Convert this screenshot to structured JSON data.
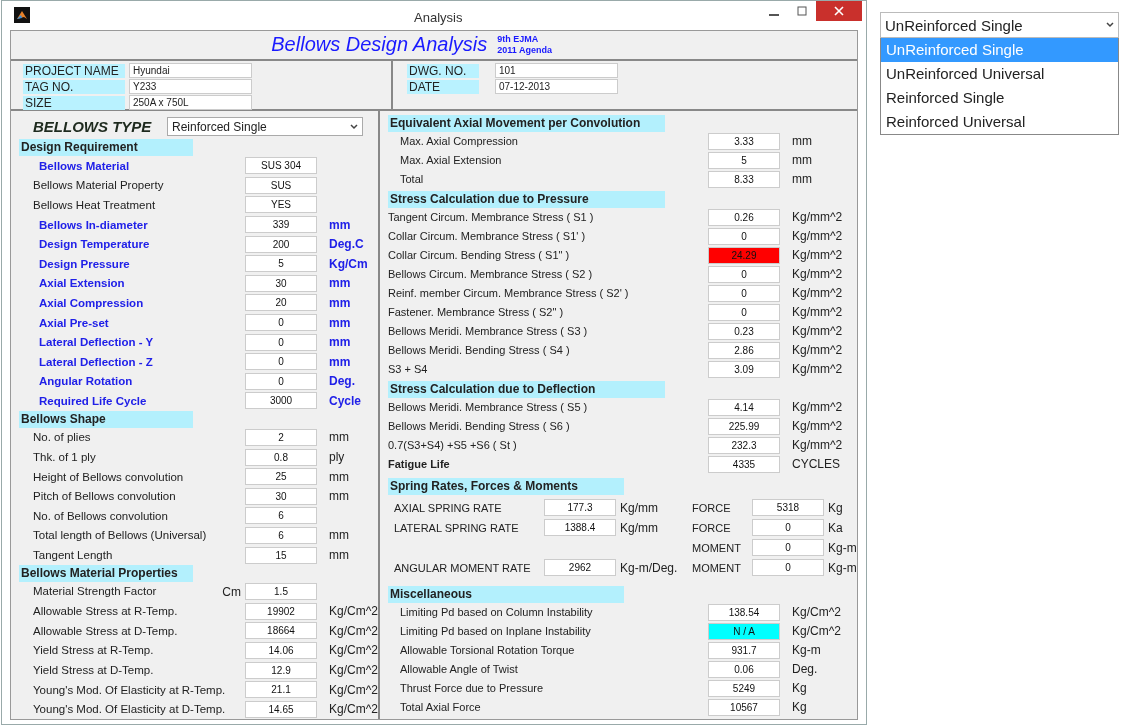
{
  "window": {
    "title": "Analysis"
  },
  "banner": {
    "title": "Bellows Design Analysis",
    "edition": "9th EJMA",
    "agenda": "2011 Agenda"
  },
  "project": [
    {
      "label": "PROJECT NAME",
      "value": "Hyundai"
    },
    {
      "label": "TAG NO.",
      "value": "Y233"
    },
    {
      "label": "SIZE",
      "value": "250A x 750L"
    }
  ],
  "drawing": [
    {
      "label": "DWG. NO.",
      "value": "101"
    },
    {
      "label": "DATE",
      "value": "07-12-2013"
    }
  ],
  "bellows_type": {
    "label": "BELLOWS TYPE",
    "value": "Reinforced Single"
  },
  "left_sections": [
    {
      "title": "Design Requirement",
      "rows": [
        {
          "kind": "key",
          "label": "Bellows  Material",
          "value": "SUS 304"
        },
        {
          "kind": "plain",
          "label": "Bellows  Material Property",
          "value": "SUS"
        },
        {
          "kind": "plain",
          "label": "Bellows  Heat Treatment",
          "value": "YES"
        },
        {
          "kind": "key",
          "label": "Bellows  In-diameter",
          "value": "339",
          "unit": "mm"
        },
        {
          "kind": "key",
          "label": "Design Temperature",
          "value": "200",
          "unit": "Deg.C"
        },
        {
          "kind": "key",
          "label": "Design Pressure",
          "value": "5",
          "unit": "Kg/Cm"
        },
        {
          "kind": "key",
          "label": "Axial Extension",
          "value": "30",
          "unit": "mm"
        },
        {
          "kind": "key",
          "label": "Axial Compression",
          "value": "20",
          "unit": "mm"
        },
        {
          "kind": "key",
          "label": "Axial Pre-set",
          "value": "0",
          "unit": "mm"
        },
        {
          "kind": "key",
          "label": "Lateral Deflection - Y",
          "value": "0",
          "unit": "mm"
        },
        {
          "kind": "key",
          "label": "Lateral Deflection - Z",
          "value": "0",
          "unit": "mm"
        },
        {
          "kind": "key",
          "label": "Angular Rotation",
          "value": "0",
          "unit": "Deg."
        },
        {
          "kind": "key",
          "label": "Required Life Cycle",
          "value": "3000",
          "unit": "Cycle"
        }
      ]
    },
    {
      "title": "Bellows Shape",
      "rows": [
        {
          "kind": "plain",
          "label": "No. of plies",
          "value": "2",
          "unit": "mm"
        },
        {
          "kind": "plain",
          "label": "Thk. of 1 ply",
          "value": "0.8",
          "unit": "ply"
        },
        {
          "kind": "plain",
          "label": "Height of Bellows convolution",
          "value": "25",
          "unit": "mm"
        },
        {
          "kind": "plain",
          "label": "Pitch of Bellows convolution",
          "value": "30",
          "unit": "mm"
        },
        {
          "kind": "plain",
          "label": "No. of Bellows convolution",
          "value": "6"
        },
        {
          "kind": "plain",
          "label": "Total length of Bellows (Universal)",
          "value": "6",
          "unit": "mm"
        },
        {
          "kind": "plain",
          "label": "Tangent Length",
          "value": "15",
          "unit": "mm"
        }
      ]
    },
    {
      "title": "Bellows Material Properties",
      "rows": [
        {
          "kind": "plain",
          "label": "Material Strength Factor",
          "symbol": "Cm",
          "value": "1.5"
        },
        {
          "kind": "plain",
          "label": "Allowable Stress at R-Temp.",
          "value": "19902",
          "unit": "Kg/Cm^2"
        },
        {
          "kind": "plain",
          "label": "Allowable Stress at D-Temp.",
          "value": "18664",
          "unit": "Kg/Cm^2"
        },
        {
          "kind": "plain",
          "label": "Yield Stress at R-Temp.",
          "value": "14.06",
          "unit": "Kg/Cm^2"
        },
        {
          "kind": "plain",
          "label": "Yield Stress at D-Temp.",
          "value": "12.9",
          "unit": "Kg/Cm^2"
        },
        {
          "kind": "plain",
          "label": "Young's Mod. Of Elasticity at R-Temp.",
          "value": "21.1",
          "unit": "Kg/Cm^2"
        },
        {
          "kind": "plain",
          "label": "Young's Mod. Of Elasticity at D-Temp.",
          "value": "14.65",
          "unit": "Kg/Cm^2"
        }
      ]
    }
  ],
  "right_sections": [
    {
      "title": "Equivalent Axial Movement per Convolution",
      "rows": [
        {
          "kind": "plain",
          "label": "Max. Axial Compression",
          "value": "3.33",
          "unit": "mm"
        },
        {
          "kind": "plain",
          "label": "Max. Axial Extension",
          "value": "5",
          "unit": "mm"
        },
        {
          "kind": "plain",
          "label": "Total",
          "value": "8.33",
          "unit": "mm"
        }
      ]
    },
    {
      "title": "Stress Calculation due to Pressure",
      "rows": [
        {
          "kind": "plain",
          "label": "Tangent Circum. Membrance Stress ( S1 )",
          "value": "0.26",
          "unit": "Kg/mm^2"
        },
        {
          "kind": "plain",
          "label": "Collar Circum. Membrance Stress ( S1' )",
          "value": "0",
          "unit": "Kg/mm^2"
        },
        {
          "kind": "plain",
          "label": "Collar Circum. Bending Stress ( S1\" )",
          "value": "24.29",
          "unit": "Kg/mm^2",
          "color": "#ff0000"
        },
        {
          "kind": "plain",
          "label": "Bellows Circum. Membrance Stress ( S2 )",
          "value": "0",
          "unit": "Kg/mm^2"
        },
        {
          "kind": "plain",
          "label": "Reinf. member Circum. Membrance Stress ( S2' )",
          "value": "0",
          "unit": "Kg/mm^2"
        },
        {
          "kind": "plain",
          "label": "Fastener. Membrance Stress ( S2\" )",
          "value": "0",
          "unit": "Kg/mm^2"
        },
        {
          "kind": "plain",
          "label": "Bellows Meridi.  Membrance Stress ( S3 )",
          "value": "0.23",
          "unit": "Kg/mm^2"
        },
        {
          "kind": "plain",
          "label": "Bellows Meridi.  Bending Stress ( S4 )",
          "value": "2.86",
          "unit": "Kg/mm^2"
        },
        {
          "kind": "plain",
          "label": "S3 + S4",
          "value": "3.09",
          "unit": "Kg/mm^2"
        }
      ]
    },
    {
      "title": "Stress Calculation due to Deflection",
      "rows": [
        {
          "kind": "plain",
          "label": "Bellows Meridi.  Membrance Stress ( S5 )",
          "value": "4.14",
          "unit": "Kg/mm^2"
        },
        {
          "kind": "plain",
          "label": "Bellows Meridi.  Bending Stress ( S6 )",
          "value": "225.99",
          "unit": "Kg/mm^2"
        },
        {
          "kind": "plain",
          "label": "0.7(S3+S4) +S5 +S6 ( St )",
          "value": "232.3",
          "unit": "Kg/mm^2"
        },
        {
          "kind": "key",
          "label": "Fatigue Life",
          "value": "4335",
          "unit": "CYCLES"
        }
      ]
    }
  ],
  "spring_rates": {
    "title": "Spring Rates, Forces & Moments",
    "rows": [
      {
        "rate": {
          "label": "AXIAL SPRING RATE",
          "value": "177.3",
          "unit": "Kg/mm"
        },
        "load": {
          "label": "FORCE",
          "value": "5318",
          "unit": "Kg"
        }
      },
      {
        "rate": {
          "label": "LATERAL SPRING RATE",
          "value": "1388.4",
          "unit": "Kg/mm"
        },
        "load": {
          "label": "FORCE",
          "value": "0",
          "unit": "Ka"
        }
      },
      {
        "load": {
          "label": "MOMENT",
          "value": "0",
          "unit": "Kg-m"
        }
      },
      {
        "rate": {
          "label": "ANGULAR MOMENT RATE",
          "value": "2962",
          "unit": "Kg-m/Deg."
        },
        "load": {
          "label": "MOMENT",
          "value": "0",
          "unit": "Kg-m"
        }
      }
    ]
  },
  "miscellaneous": {
    "title": "Miscellaneous",
    "rows": [
      {
        "label": "Limiting Pd based on Column Instability",
        "value": "138.54",
        "unit": "Kg/Cm^2"
      },
      {
        "label": "Limiting Pd based on Inplane Instability",
        "value": "N / A",
        "unit": "Kg/Cm^2",
        "color": "#00ffff"
      },
      {
        "label": "Allowable Torsional Rotation Torque",
        "value": "931.7",
        "unit": "Kg-m"
      },
      {
        "label": "Allowable Angle of Twist",
        "value": "0.06",
        "unit": "Deg."
      },
      {
        "label": "Thrust Force due to Pressure",
        "value": "5249",
        "unit": "Kg"
      },
      {
        "label": "Total Axial Force",
        "value": "10567",
        "unit": "Kg"
      }
    ]
  },
  "type_dropdown": {
    "value": "UnReinforced Single",
    "options": [
      {
        "label": "UnReinforced Single",
        "selected": true
      },
      {
        "label": "UnReinforced Universal",
        "selected": false
      },
      {
        "label": "Reinforced Single",
        "selected": false
      },
      {
        "label": "Reinforced Universal",
        "selected": false
      }
    ]
  }
}
